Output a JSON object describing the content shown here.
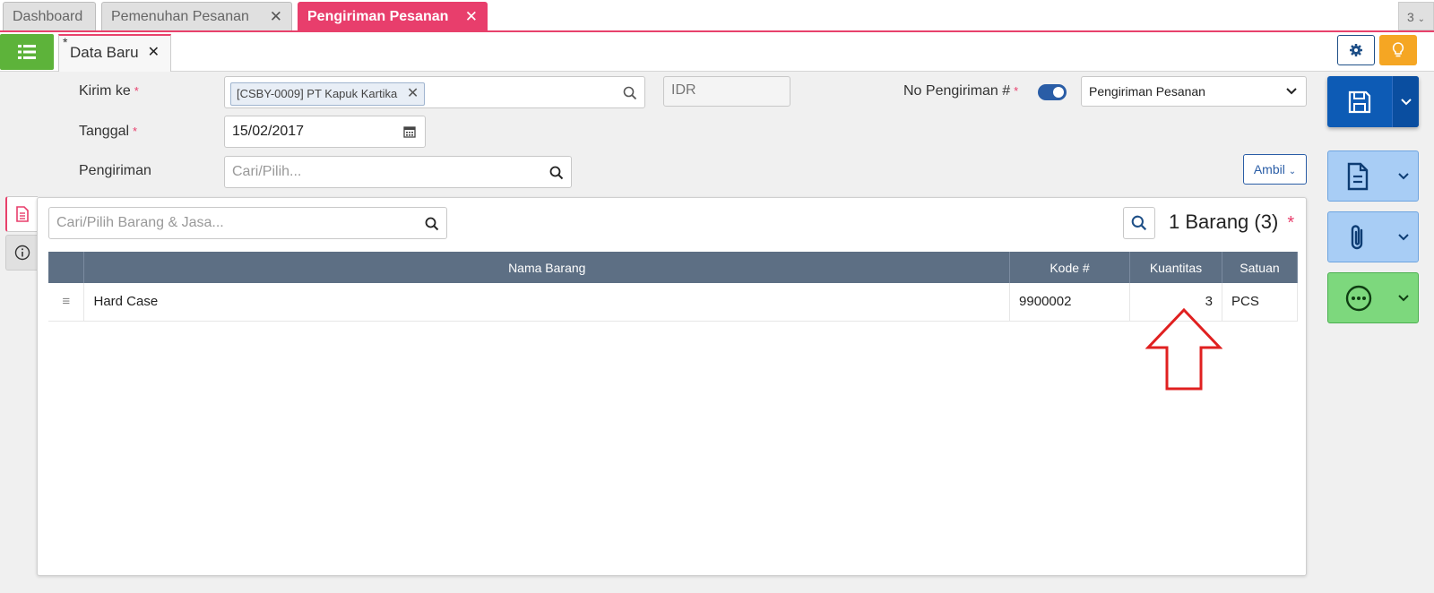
{
  "top_tabs": {
    "tabs": [
      {
        "label": "Dashboard"
      },
      {
        "label": "Pemenuhan Pesanan"
      },
      {
        "label": "Pengiriman Pesanan"
      }
    ],
    "count": "3",
    "active_color": "#e83e6c"
  },
  "doc_tab": {
    "star": "*",
    "label": "Data Baru"
  },
  "form": {
    "kirim_ke_label": "Kirim ke",
    "kirim_ke_chip": "[CSBY-0009] PT Kapuk Kartika",
    "currency": "IDR",
    "no_pengiriman_label": "No Pengiriman #",
    "no_pengiriman_select": "Pengiriman Pesanan",
    "tanggal_label": "Tanggal",
    "tanggal_value": "15/02/2017",
    "pengiriman_label": "Pengiriman",
    "pengiriman_placeholder": "Cari/Pilih...",
    "ambil_label": "Ambil",
    "required_mark": "*"
  },
  "panel": {
    "search_placeholder": "Cari/Pilih Barang & Jasa...",
    "count_label": "1 Barang (3)",
    "required_mark": "*",
    "columns": [
      "Nama Barang",
      "Kode #",
      "Kuantitas",
      "Satuan"
    ],
    "rows": [
      {
        "nama": "Hard Case",
        "kode": "9900002",
        "kuantitas": "3",
        "satuan": "PCS"
      }
    ]
  },
  "colors": {
    "header": "#5d6f84",
    "primary": "#0d5bb5",
    "green": "#5db33a",
    "orange": "#f5a623",
    "annotation": "#e02020"
  }
}
